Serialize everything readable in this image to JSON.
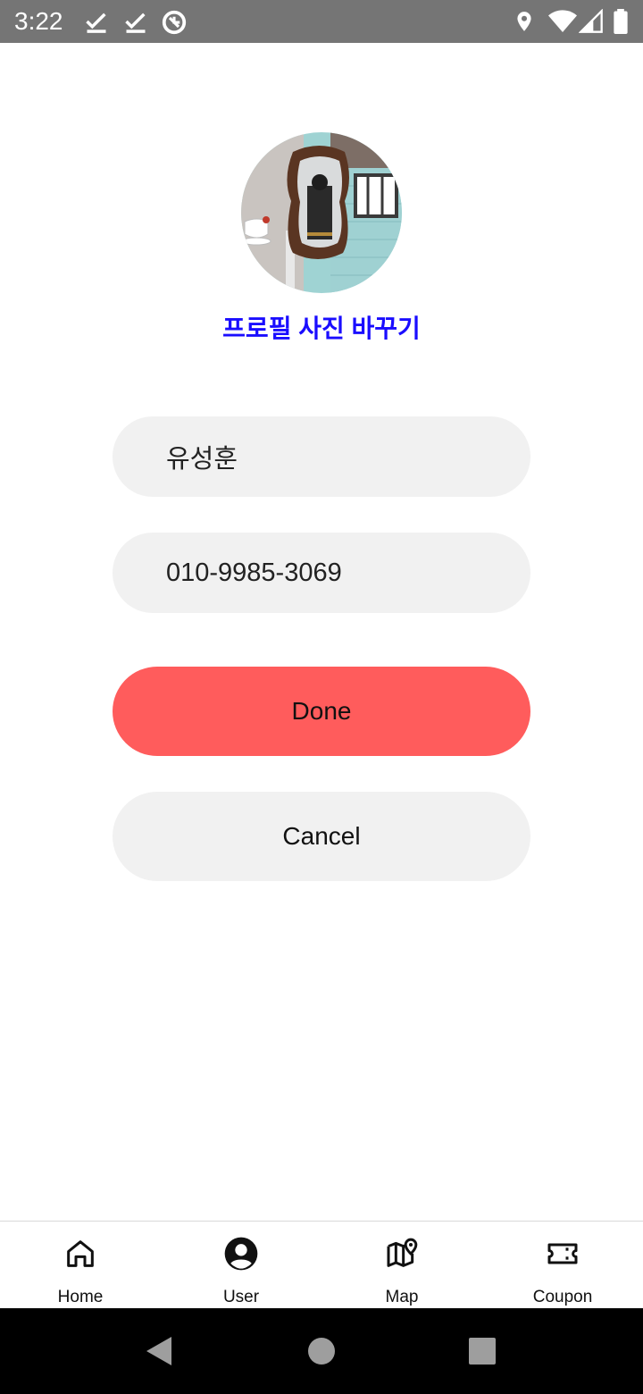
{
  "status_bar": {
    "time": "3:22",
    "left_icons": [
      "check-icon",
      "check-icon",
      "sync-icon"
    ],
    "right_icons": [
      "location-icon",
      "wifi-icon",
      "signal-icon",
      "battery-icon"
    ]
  },
  "profile": {
    "change_photo_label": "프로필 사진 바꾸기",
    "name_value": "유성훈",
    "phone_value": "010-9985-3069"
  },
  "actions": {
    "done_label": "Done",
    "cancel_label": "Cancel"
  },
  "bottom_nav": {
    "items": [
      {
        "label": "Home",
        "icon": "home-icon"
      },
      {
        "label": "User",
        "icon": "user-icon",
        "active": true
      },
      {
        "label": "Map",
        "icon": "map-icon"
      },
      {
        "label": "Coupon",
        "icon": "coupon-icon"
      }
    ]
  },
  "colors": {
    "status_bar": "#757575",
    "link": "#1a0dff",
    "done": "#ff5c5c",
    "field_bg": "#f1f1f1"
  }
}
